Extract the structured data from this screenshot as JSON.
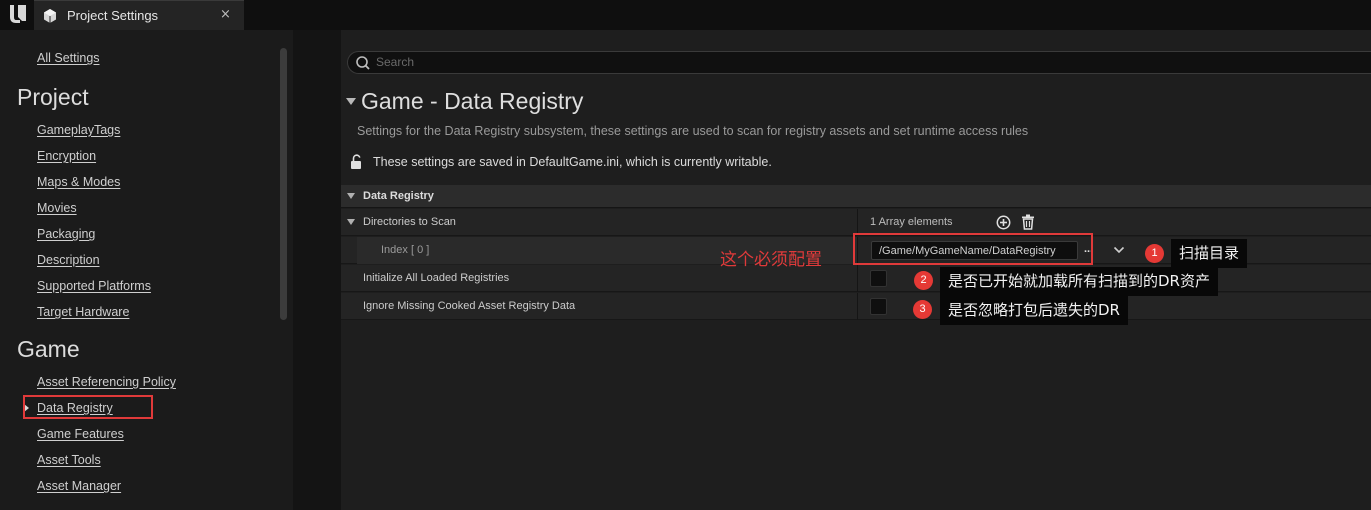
{
  "window": {
    "tab_title": "Project Settings",
    "tab_close": "×"
  },
  "sidebar": {
    "all_settings": "All Settings",
    "categories": [
      {
        "title": "Project",
        "items": [
          "GameplayTags",
          "Encryption",
          "Maps & Modes",
          "Movies",
          "Packaging",
          "Description",
          "Supported Platforms",
          "Target Hardware"
        ]
      },
      {
        "title": "Game",
        "items": [
          "Asset Referencing Policy",
          "Data Registry",
          "Game Features",
          "Asset Tools",
          "Asset Manager"
        ]
      }
    ],
    "selected_item": "Data Registry"
  },
  "main": {
    "search_placeholder": "Search",
    "section_title": "Game - Data Registry",
    "section_description": "Settings for the Data Registry subsystem, these settings are used to scan for registry assets and set runtime access rules",
    "saved_note": "These settings are saved in DefaultGame.ini, which is currently writable.",
    "category": "Data Registry",
    "properties": {
      "directories_label": "Directories to Scan",
      "array_count": "1 Array elements",
      "index_label": "Index [ 0 ]",
      "index_value": "/Game/MyGameName/DataRegistry",
      "ellipsis": "...",
      "init_label": "Initialize All Loaded Registries",
      "init_checked": false,
      "ignore_label": "Ignore Missing Cooked Asset Registry Data",
      "ignore_checked": false
    }
  },
  "annotations": {
    "required_note": "这个必须配置",
    "badge1": "1",
    "callout1": "扫描目录",
    "badge2": "2",
    "callout2": "是否已开始就加载所有扫描到的DR资产",
    "badge3": "3",
    "callout3": "是否忽略打包后遗失的DR",
    "highlight_color": "#e03a3a",
    "badge_color": "#e53935"
  }
}
